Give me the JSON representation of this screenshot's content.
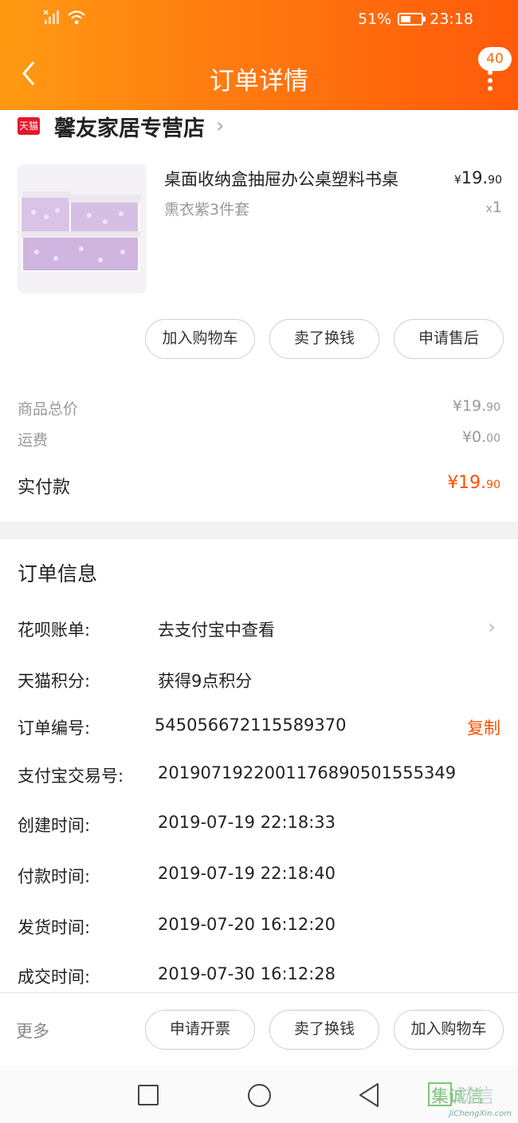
{
  "status_bar": {
    "battery": "51%",
    "time": "23:18"
  },
  "nav": {
    "title": "订单详情",
    "badge_count": "40"
  },
  "store": {
    "badge": "天猫",
    "name": "馨友家居专营店"
  },
  "product": {
    "title": "桌面收纳盒抽屉办公桌塑料书桌",
    "sku": "熏衣紫3件套",
    "currency": "¥",
    "price_int": "19.",
    "price_dec": "90",
    "qty_prefix": "x",
    "qty": "1",
    "image_color": "#d9c3e6"
  },
  "item_actions": [
    "加入购物车",
    "卖了换钱",
    "申请售后"
  ],
  "costs": {
    "subtotal_label": "商品总价",
    "subtotal_int": "¥19.",
    "subtotal_dec": "90",
    "shipping_label": "运费",
    "shipping_int": "¥0.",
    "shipping_dec": "00",
    "total_label": "实付款",
    "total_int": "¥19.",
    "total_dec": "90"
  },
  "order_info": {
    "title": "订单信息",
    "rows": [
      {
        "label": "花呗账单:",
        "value": "去支付宝中查看"
      },
      {
        "label": "天猫积分:",
        "value": "获得9点积分"
      },
      {
        "label": "订单编号:",
        "value": "545056672115589370",
        "action": "复制"
      },
      {
        "label": "支付宝交易号:",
        "value": "2019071922001176890501555349"
      },
      {
        "label": "创建时间:",
        "value": "2019-07-19 22:18:33"
      },
      {
        "label": "付款时间:",
        "value": "2019-07-19 22:18:40"
      },
      {
        "label": "发货时间:",
        "value": "2019-07-20 16:12:20"
      },
      {
        "label": "成交时间:",
        "value": "2019-07-30 16:12:28"
      }
    ]
  },
  "bottom_bar": {
    "more_label": "更多",
    "buttons": [
      "申请开票",
      "卖了换钱",
      "加入购物车"
    ]
  },
  "watermark": {
    "logo_text": "集诚信",
    "url_text": "JiChengXin.com"
  },
  "colors": {
    "accent": "#ff5000",
    "header_start": "#ff9a12",
    "header_end": "#ff5a0a"
  }
}
